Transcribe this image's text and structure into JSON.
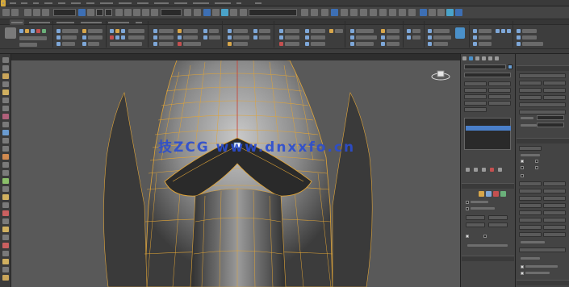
{
  "viewport": {
    "watermark": "技ZCG www.dnxxfo.cn"
  },
  "colors": {
    "wire": "#e0a437",
    "mesh_light": "#b7b7b7",
    "mesh_dark": "#3a3a3a",
    "selection": "#4a7fc9",
    "viewport_bg": "#595959",
    "watermark": "#2b4dd1"
  },
  "icons": [
    "undo-icon",
    "redo-icon",
    "link-icon",
    "unlink-icon",
    "select-icon",
    "move-icon",
    "rotate-icon",
    "scale-icon",
    "snap-icon",
    "mirror-icon",
    "align-icon",
    "layer-icon",
    "render-icon",
    "material-icon",
    "render-frame-icon",
    "viewcube-icon",
    "create-icon",
    "modify-icon",
    "hierarchy-icon",
    "motion-icon",
    "display-icon",
    "utilities-icon"
  ]
}
